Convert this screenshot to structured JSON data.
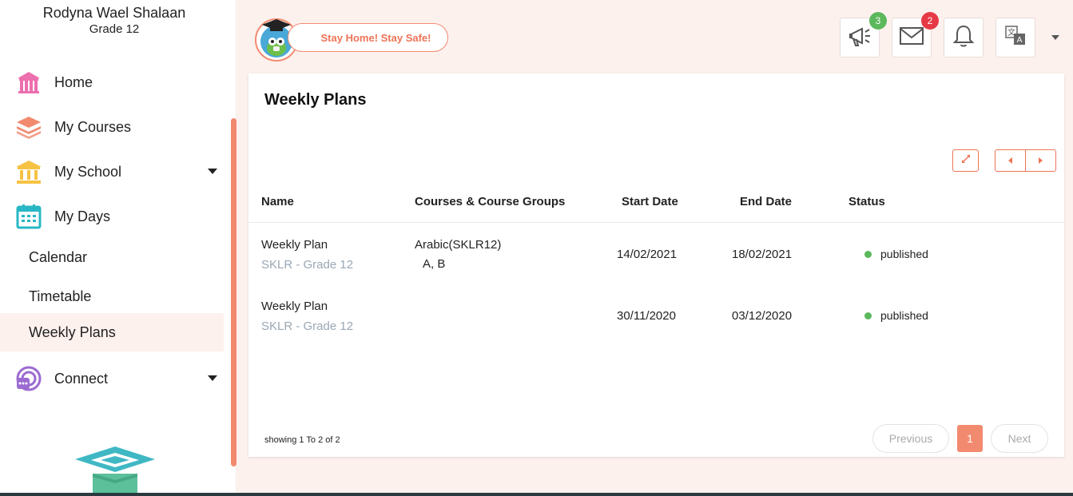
{
  "user": {
    "name": "Rodyna Wael Shalaan",
    "grade": "Grade 12"
  },
  "sidebar": {
    "items": [
      {
        "label": "Home",
        "icon": "home-icon"
      },
      {
        "label": "My Courses",
        "icon": "courses-icon"
      },
      {
        "label": "My School",
        "icon": "school-icon"
      },
      {
        "label": "My Days",
        "icon": "calendar-icon"
      }
    ],
    "sub_items": [
      "Calendar",
      "Timetable",
      "Weekly Plans"
    ],
    "connect": {
      "label": "Connect",
      "icon": "connect-icon"
    },
    "active": "Weekly Plans"
  },
  "topbar": {
    "banner": "Stay Home! Stay Safe!",
    "announcements_badge": "3",
    "messages_badge": "2",
    "icons": [
      "megaphone-icon",
      "envelope-icon",
      "bell-icon",
      "translate-icon"
    ]
  },
  "main": {
    "title": "Weekly Plans",
    "columns": [
      "Name",
      "Courses & Course Groups",
      "Start Date",
      "End Date",
      "Status"
    ],
    "rows": [
      {
        "name": "Weekly Plan",
        "subtitle": "SKLR - Grade 12",
        "course": "Arabic(SKLR12)",
        "groups": "A, B",
        "start": "14/02/2021",
        "end": "18/02/2021",
        "status": "published"
      },
      {
        "name": "Weekly Plan",
        "subtitle": "SKLR - Grade 12",
        "course": "",
        "groups": "",
        "start": "30/11/2020",
        "end": "03/12/2020",
        "status": "published"
      }
    ],
    "showing": "showing 1 To 2 of 2",
    "pagination": {
      "previous": "Previous",
      "page": "1",
      "next": "Next"
    }
  },
  "colors": {
    "accent": "#f28a6f",
    "status_published": "#5cb85c",
    "badge_green": "#5cb85c",
    "badge_red": "#e63946"
  }
}
